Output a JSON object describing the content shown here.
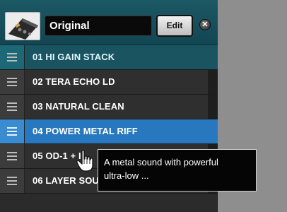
{
  "header": {
    "preset_name": "Original",
    "edit_label": "Edit",
    "close_symbol": "✕",
    "thumbnail_icon": "amp-device-icon"
  },
  "patches": [
    {
      "label": "01  HI GAIN STACK",
      "state": "active"
    },
    {
      "label": "02  TERA ECHO LD",
      "state": "normal"
    },
    {
      "label": "03  NATURAL CLEAN",
      "state": "normal"
    },
    {
      "label": "04  POWER METAL RIFF",
      "state": "hover"
    },
    {
      "label": "05  OD-1 + I",
      "state": "normal"
    },
    {
      "label": "06  LAYER SOUND",
      "state": "normal"
    }
  ],
  "tooltip": {
    "line1": "A metal sound with powerful",
    "line2": "ultra-low ..."
  },
  "colors": {
    "active_row": "#1a5461",
    "hover_row": "#2878bf",
    "panel_bg": "#2b2b2b",
    "right_area": "#8e8e8e"
  },
  "cursor_icon": "hand-pointer-icon"
}
